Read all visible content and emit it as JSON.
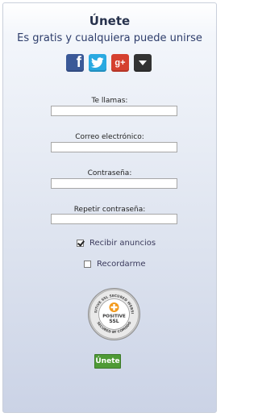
{
  "header": {
    "title": "Únete",
    "subtitle": "Es gratis y cualquiera puede unirse"
  },
  "social": {
    "facebook_glyph": "f",
    "googleplus_glyph": "g+",
    "icons": [
      "facebook-icon",
      "twitter-icon",
      "googleplus-icon",
      "more-dropdown-icon"
    ]
  },
  "form": {
    "name_label": "Te llamas:",
    "name_value": "",
    "email_label": "Correo electrónico:",
    "email_value": "",
    "password_label": "Contraseña:",
    "password_value": "",
    "repeat_password_label": "Repetir contraseña:",
    "repeat_password_value": "",
    "receive_ads_label": "Recibir anuncios",
    "receive_ads_checked": true,
    "remember_label": "Recordarme",
    "remember_checked": false,
    "submit_label": "Únete"
  },
  "seal": {
    "top_text": "POSITIVE SSL SECURED WEBSITE",
    "middle_line1": "POSITIVE",
    "middle_line2": "SSL",
    "bottom_text": "SECURED BY COMODO"
  },
  "colors": {
    "submit": "#4e9a35",
    "facebook": "#3b5998",
    "twitter": "#29a9e1",
    "googleplus": "#d5402f"
  }
}
